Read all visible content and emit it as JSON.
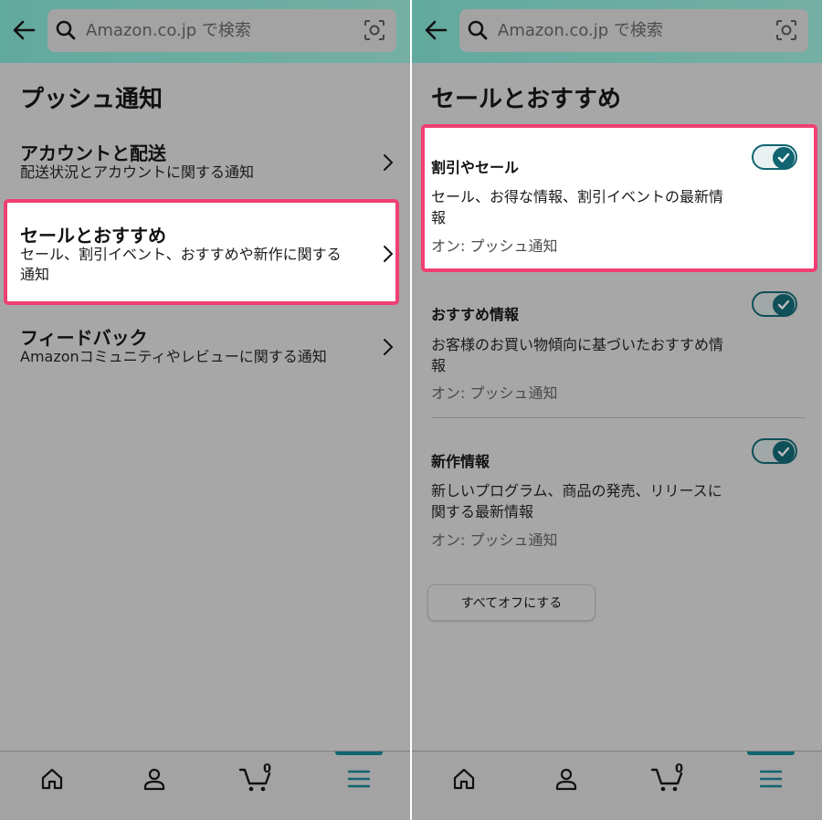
{
  "search": {
    "placeholder": "Amazon.co.jp で検索"
  },
  "left": {
    "title": "プッシュ通知",
    "rows": [
      {
        "title": "アカウントと配送",
        "subtitle": "配送状況とアカウントに関する通知"
      },
      {
        "title": "セールとおすすめ",
        "subtitle": "セール、割引イベント、おすすめや新作に関する通知"
      },
      {
        "title": "フィードバック",
        "subtitle": "Amazonコミュニティやレビューに関する通知"
      }
    ]
  },
  "right": {
    "title": "セールとおすすめ",
    "settings": [
      {
        "title": "割引やセール",
        "description": "セール、お得な情報、割引イベントの最新情報",
        "status": "オン: プッシュ通知",
        "enabled": true
      },
      {
        "title": "おすすめ情報",
        "description": "お客様のお買い物傾向に基づいたおすすめ情報",
        "status": "オン: プッシュ通知",
        "enabled": true
      },
      {
        "title": "新作情報",
        "description": "新しいプログラム、商品の発売、リリースに関する最新情報",
        "status": "オン: プッシュ通知",
        "enabled": true
      }
    ],
    "all_off_button": "すべてオフにする"
  },
  "bottom_nav": {
    "items": [
      "home-icon",
      "account-icon",
      "cart-icon",
      "menu-icon"
    ],
    "cart_count": "0",
    "active_item": "menu-icon"
  },
  "colors": {
    "highlight_border": "#ef3f73",
    "toggle_on": "#116571",
    "header": "#6aab9f"
  }
}
